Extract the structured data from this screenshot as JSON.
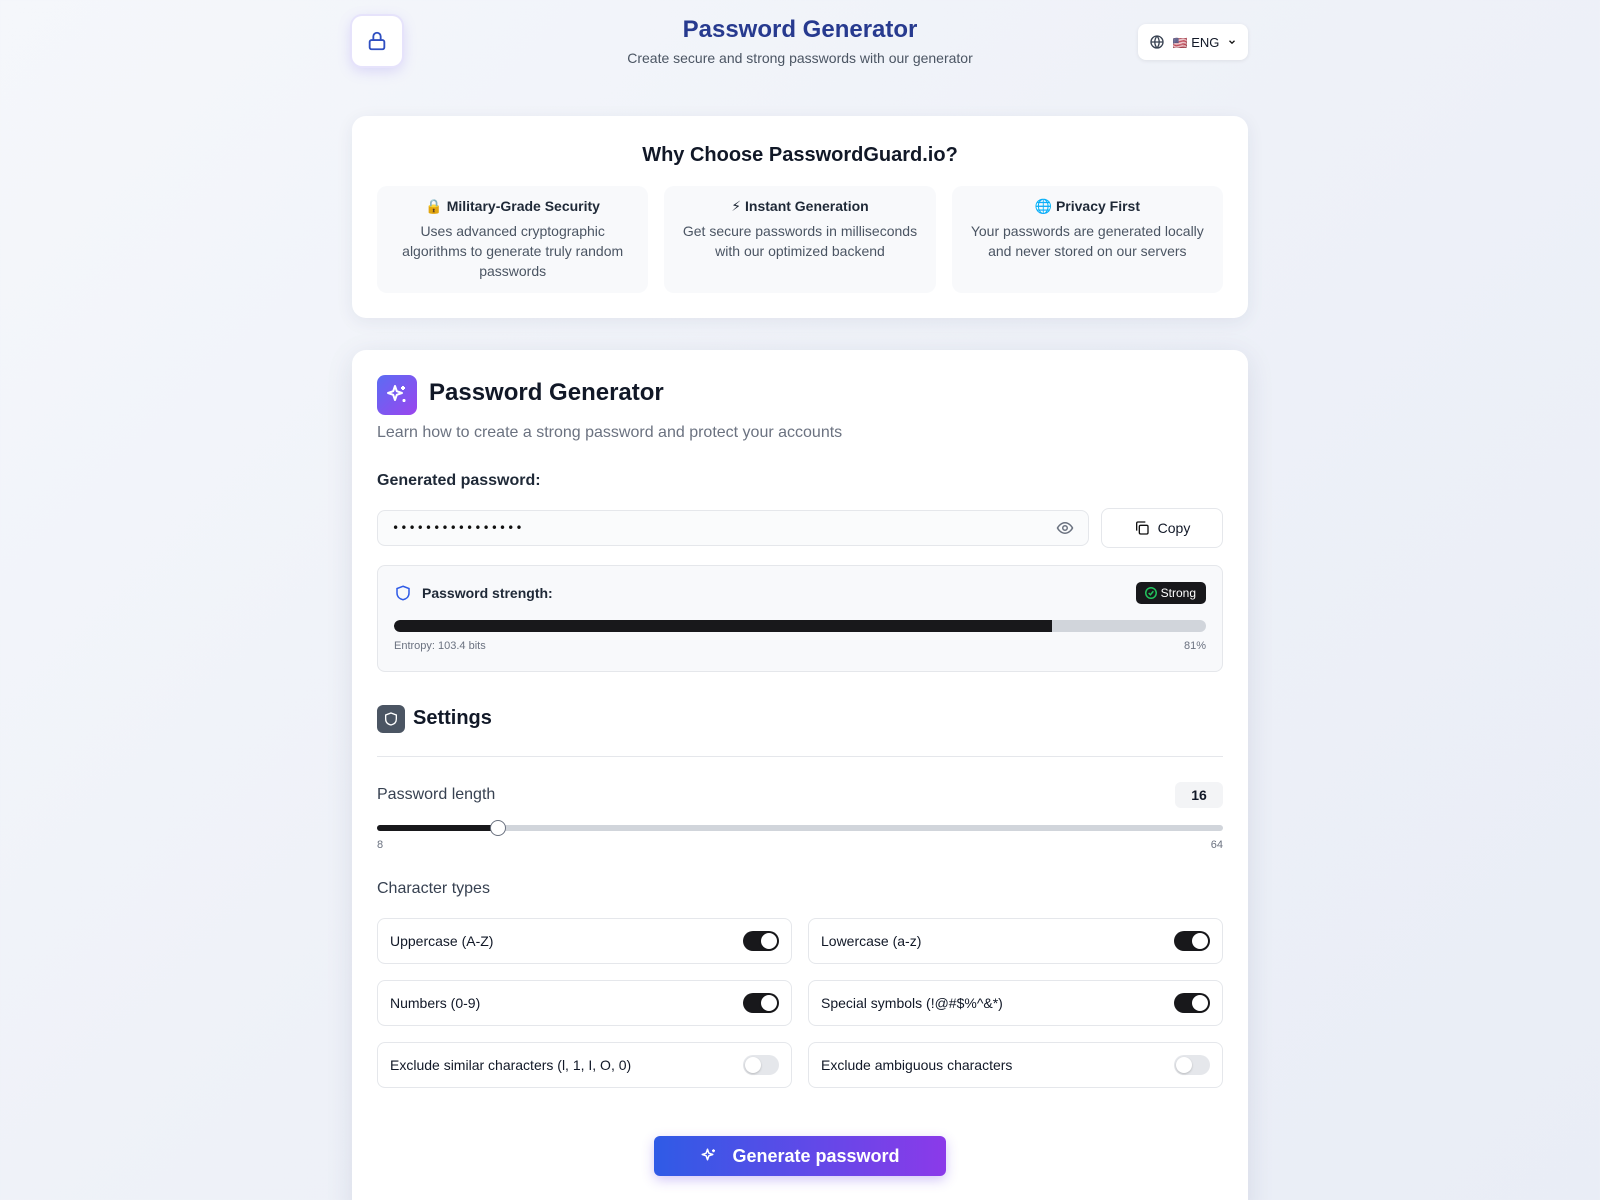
{
  "header": {
    "title": "Password Generator",
    "subtitle": "Create secure and strong passwords with our generator",
    "logo_icon": "lock-icon",
    "language": {
      "flag": "🇺🇸",
      "label": "ENG"
    }
  },
  "why": {
    "title": "Why Choose PasswordGuard.io?",
    "features": [
      {
        "emoji": "🔒",
        "title": "Military-Grade Security",
        "description": "Uses advanced cryptographic algorithms to generate truly random passwords"
      },
      {
        "emoji": "⚡",
        "title": "Instant Generation",
        "description": "Get secure passwords in milliseconds with our optimized backend"
      },
      {
        "emoji": "🌐",
        "title": "Privacy First",
        "description": "Your passwords are generated locally and never stored on our servers"
      }
    ]
  },
  "generator": {
    "title": "Password Generator",
    "subtitle": "Learn how to create a strong password and protect your accounts",
    "generated_label": "Generated password:",
    "password_masked": "••••••••••••••••",
    "copy_label": "Copy",
    "strength": {
      "label": "Password strength:",
      "badge": "Strong",
      "percent_value": 81,
      "entropy_text": "Entropy: 103.4 bits",
      "percent_text": "81%"
    }
  },
  "settings": {
    "title": "Settings",
    "length_label": "Password length",
    "length_value": "16",
    "length_current": 16,
    "length_min": 8,
    "length_max": 64,
    "length_min_text": "8",
    "length_max_text": "64",
    "char_types_label": "Character types",
    "options": [
      {
        "label": "Uppercase (A-Z)",
        "on": true
      },
      {
        "label": "Lowercase (a-z)",
        "on": true
      },
      {
        "label": "Numbers (0-9)",
        "on": true
      },
      {
        "label": "Special symbols (!@#$%^&*)",
        "on": true
      },
      {
        "label": "Exclude similar characters (l, 1, I, O, 0)",
        "on": false
      },
      {
        "label": "Exclude ambiguous characters",
        "on": false
      }
    ]
  },
  "actions": {
    "generate_label": "Generate password"
  },
  "colors": {
    "accent_start": "#2f5be6",
    "accent_end": "#8b3ae9",
    "title_blue": "#273a8f",
    "dark": "#18181b"
  }
}
